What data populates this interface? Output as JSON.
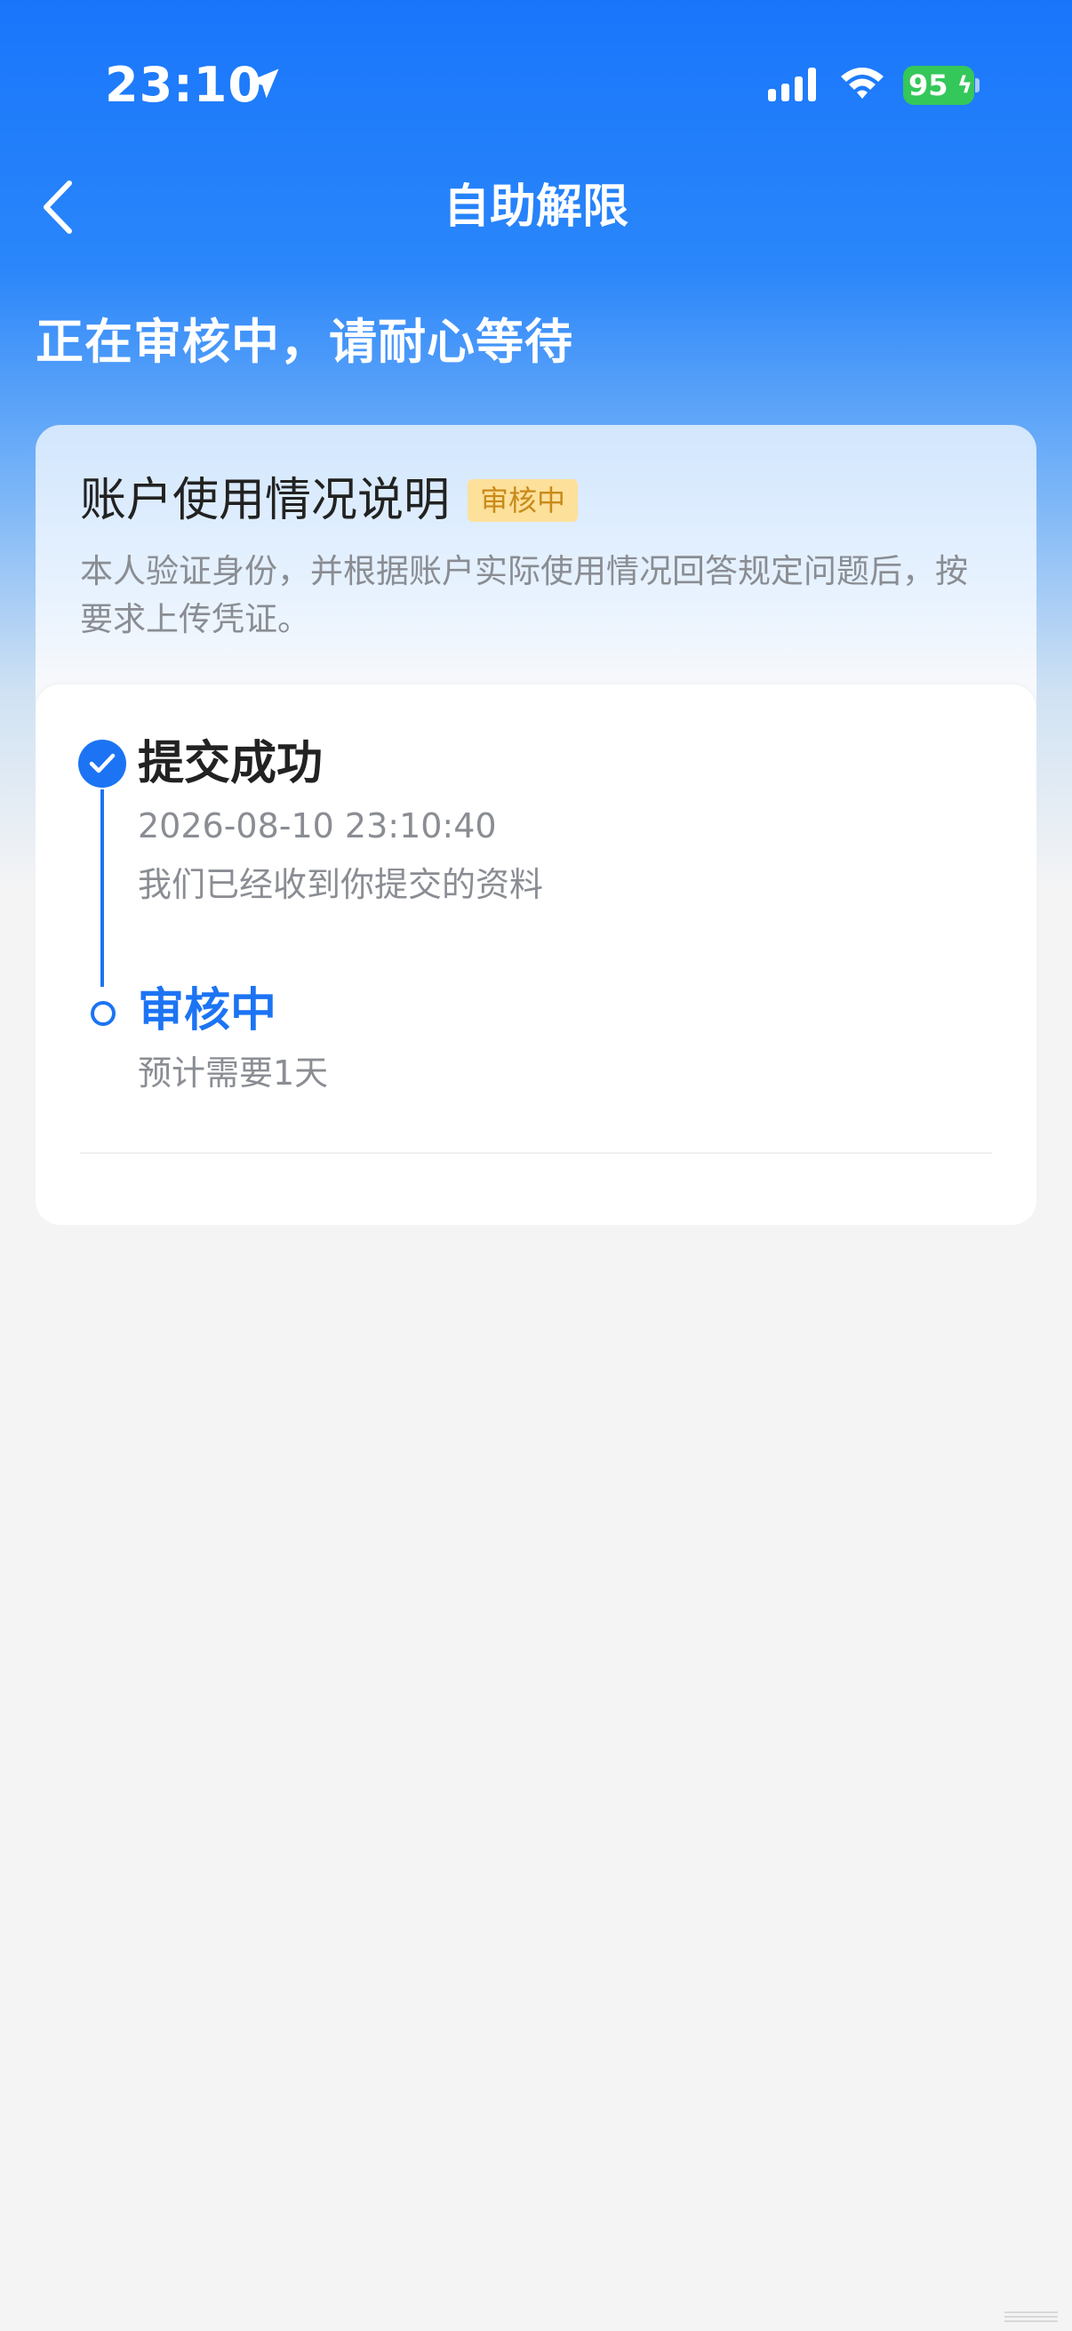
{
  "status_bar": {
    "time": "23:10",
    "battery_level": "95",
    "icons": [
      "location-arrow-icon",
      "cellular-signal-icon",
      "wifi-icon",
      "battery-icon"
    ]
  },
  "nav": {
    "title": "自助解限",
    "back_icon": "chevron-left-icon"
  },
  "review_status": "正在审核中，请耐心等待",
  "card": {
    "title": "账户使用情况说明",
    "tag": "审核中",
    "description": "本人验证身份，并根据账户实际使用情况回答规定问题后，按要求上传凭证。"
  },
  "timeline": {
    "steps": [
      {
        "title": "提交成功",
        "time": "2026-08-10 23:10:40",
        "note": "我们已经收到你提交的资料",
        "state": "completed"
      },
      {
        "title": "审核中",
        "note": "预计需要1天",
        "state": "current"
      }
    ]
  },
  "colors": {
    "primary": "#1c74f4",
    "header_gradient_top": "#1976fb",
    "tag_bg": "#fde09a",
    "tag_text": "#c98a1a",
    "page_bg": "#f4f4f5"
  }
}
